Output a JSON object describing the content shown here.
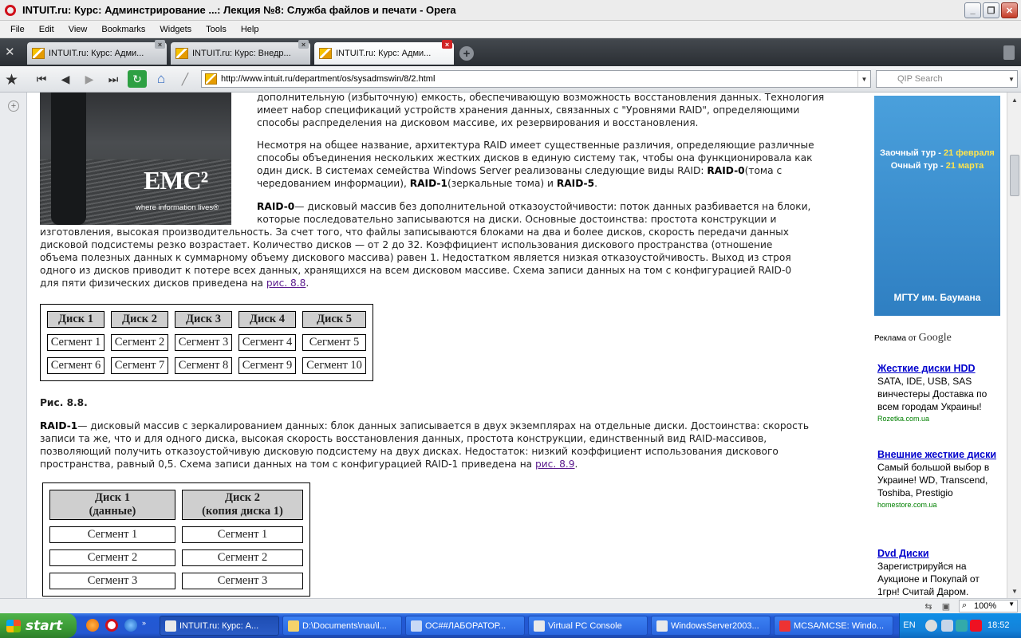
{
  "window": {
    "title": "INTUIT.ru: Курс: Админстрирование ...: Лекция №8: Служба файлов и печати - Opera"
  },
  "menu": [
    "File",
    "Edit",
    "View",
    "Bookmarks",
    "Widgets",
    "Tools",
    "Help"
  ],
  "tabs": [
    {
      "label": "INTUIT.ru: Курс: Адми..."
    },
    {
      "label": "INTUIT.ru: Курс: Внедр..."
    },
    {
      "label": "INTUIT.ru: Курс: Адми..."
    }
  ],
  "address": {
    "url": "http://www.intuit.ru/department/os/sysadmswin/8/2.html"
  },
  "search": {
    "placeholder": "QIP Search"
  },
  "article": {
    "p1_lines": [
      "дополнительную (избыточную) емкость, обеспечивающую возможность восстановления данных. Технология",
      "имеет набор спецификаций устройств хранения данных, связанных с \"Уровнями RAID\", определяющими",
      "способы распределения на дисковом массиве, их резервирования и восстановления."
    ],
    "p2_lines": [
      "Несмотря на общее название, архитектура RAID имеет существенные различия, определяющие различные",
      "способы объединения нескольких жестких дисков в единую систему так, чтобы она функционировала как",
      "один диск. В системах семейства Windows Server реализованы следующие виды RAID: ",
      "RAID-0",
      "(тома с",
      "чередованием информации), ",
      "RAID-1",
      "(зеркальные тома) и ",
      "RAID-5",
      "."
    ],
    "p3_lines": [
      "RAID-0",
      "— дисковый массив без дополнительной отказоустойчивости: поток данных разбивается на блоки,",
      "которые последовательно записываются на диски. Основные достоинства: простота конструкции и",
      "изготовления, высокая производительность. За счет того, что файлы записываются блоками на два и более дисков, скорость передачи данных",
      "дисковой подсистемы резко возрастает. Количество дисков — от 2 до 32. Коэффициент использования дискового пространства (отношение",
      "объема полезных данных к суммарному объему дискового массива) равен 1. Недостатком является низкая отказоустойчивость. Выход из строя",
      "одного из дисков приводит к потере всех данных, хранящихся на всем дисковом массиве. Схема записи данных на том с конфигурацией RAID-0",
      "для пяти физических дисков приведена на ",
      "рис. 8.8",
      "."
    ],
    "fig88": {
      "headers": [
        "Диск 1",
        "Диск 2",
        "Диск 3",
        "Диск 4",
        "Диск 5"
      ],
      "rows": [
        [
          "Сегмент 1",
          "Сегмент 2",
          "Сегмент 3",
          "Сегмент 4",
          "Сегмент 5"
        ],
        [
          "Сегмент 6",
          "Сегмент 7",
          "Сегмент 8",
          "Сегмент 9",
          "Сегмент 10"
        ]
      ],
      "caption": "Рис. 8.8."
    },
    "p4_lines": [
      "RAID-1",
      "— дисковый массив с зеркалированием данных: блок данных записывается в двух экземплярах на отдельные диски. Достоинства: скорость",
      "записи та же, что и для одного диска, высокая скорость восстановления данных, простота конструкции, единственный вид RAID-массивов,",
      "позволяющий получить отказоустойчивую дисковую подсистему на двух дисках. Недостаток: низкий коэффициент использования дискового",
      "пространства, равный 0,5. Схема записи данных на том с конфигурацией RAID-1 приведена на ",
      "рис. 8.9",
      "."
    ],
    "fig89": {
      "headers": [
        [
          "Диск 1",
          "(данные)"
        ],
        [
          "Диск 2",
          "(копия диска 1)"
        ]
      ],
      "rows": [
        [
          "Сегмент 1",
          "Сегмент 1"
        ],
        [
          "Сегмент 2",
          "Сегмент 2"
        ],
        [
          "Сегмент 3",
          "Сегмент 3"
        ]
      ]
    },
    "emc": {
      "logo": "EMC²",
      "tagline": "where information lives®"
    }
  },
  "banner": {
    "line1_prefix": "Заочный тур - ",
    "line1_date": "21 февраля",
    "line2_prefix": "Очный тур - ",
    "line2_date": "21 марта",
    "footer": "МГТУ им. Баумана"
  },
  "ads": {
    "header": "Реклама от",
    "google": "Google",
    "items": [
      {
        "title": "Жесткие диски HDD",
        "desc": "SATA, IDE, USB, SAS винчестеры Доставка по всем городам Украины!",
        "url": "Rozetka.com.ua"
      },
      {
        "title": "Внешние жесткие диски",
        "desc": "Самый большой выбор в Украине! WD, Transcend, Toshiba, Prestigio",
        "url": "homestore.com.ua"
      },
      {
        "title": "Dvd Диски",
        "desc": "Зарегистрируйся на Аукционе и Покупай от 1грн! Считай Даром.",
        "url": ""
      }
    ]
  },
  "status": {
    "zoom": "100%"
  },
  "taskbar": {
    "start": "start",
    "tasks": [
      {
        "label": "INTUIT.ru: Курс: А..."
      },
      {
        "label": "D:\\Documents\\nau\\l..."
      },
      {
        "label": "ОС##ЛАБОРАТОР..."
      },
      {
        "label": "Virtual PC Console"
      },
      {
        "label": "WindowsServer2003..."
      },
      {
        "label": "MCSA/MCSE: Windo..."
      }
    ],
    "lang": "EN",
    "clock": "18:52"
  }
}
